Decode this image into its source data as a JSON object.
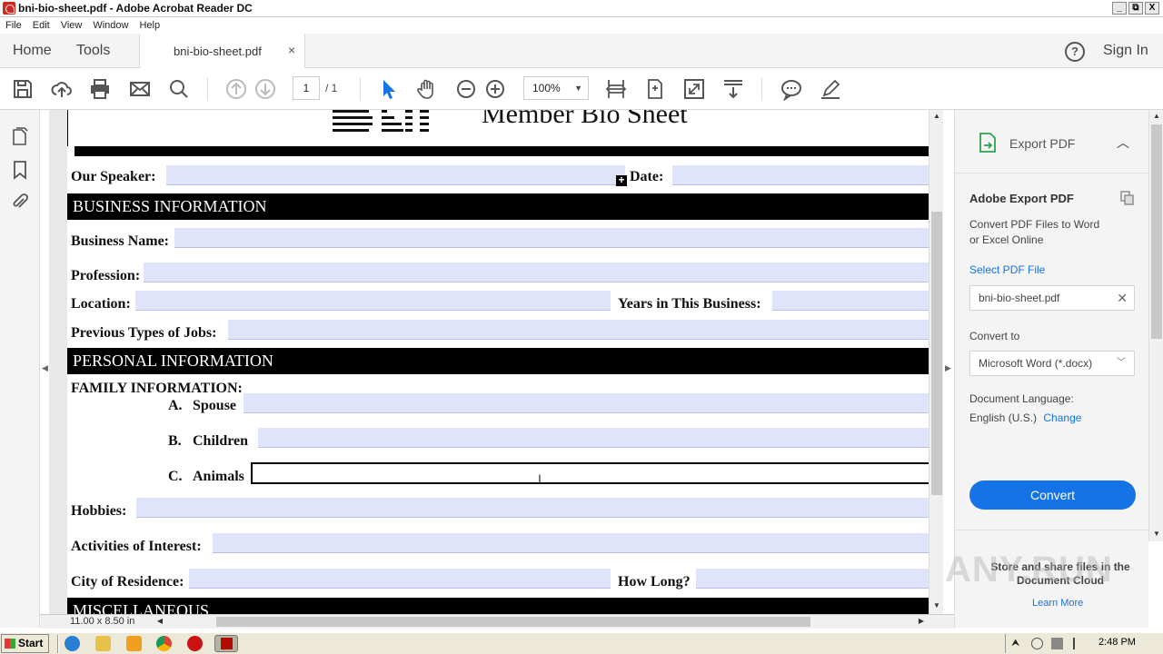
{
  "window": {
    "title": "bni-bio-sheet.pdf - Adobe Acrobat Reader DC",
    "buttons": [
      "_",
      "⧉",
      "X"
    ]
  },
  "menubar": [
    "File",
    "Edit",
    "View",
    "Window",
    "Help"
  ],
  "tabs": {
    "home": "Home",
    "tools": "Tools",
    "document_tab": "bni-bio-sheet.pdf",
    "close": "×",
    "help": "?",
    "sign_in": "Sign In"
  },
  "toolbar": {
    "page_current": "1",
    "page_total": "/ 1",
    "zoom": "100%"
  },
  "document": {
    "title": "Member Bio Sheet",
    "logo_text": "BNI",
    "fields": {
      "speaker": "Our Speaker:",
      "date": "Date:",
      "business_name": "Business Name:",
      "profession": "Profession:",
      "location": "Location:",
      "years": "Years in This Business:",
      "previous_jobs": "Previous Types of Jobs:",
      "family": "FAMILY INFORMATION:",
      "spouse_letter": "A.",
      "spouse": "Spouse",
      "children_letter": "B.",
      "children": "Children",
      "animals_letter": "C.",
      "animals": "Animals",
      "hobbies": "Hobbies:",
      "activities": "Activities of Interest:",
      "city": "City of Residence:",
      "how_long": "How Long?"
    },
    "sections": {
      "business": "BUSINESS INFORMATION",
      "personal": "PERSONAL INFORMATION",
      "misc": "MISCELLANEOUS"
    },
    "page_size": "11.00 x 8.50 in"
  },
  "right_panel": {
    "header": "Export PDF",
    "title": "Adobe Export PDF",
    "description_line1": "Convert PDF Files to Word",
    "description_line2": "or Excel Online",
    "select_label": "Select PDF File",
    "file_name": "bni-bio-sheet.pdf",
    "convert_to_label": "Convert to",
    "convert_to_value": "Microsoft Word (*.docx)",
    "language_label": "Document Language:",
    "language_value": "English (U.S.)",
    "language_change": "Change",
    "convert_button": "Convert",
    "cloud_line1": "Store and share files in the",
    "cloud_line2": "Document Cloud",
    "learn_more": "Learn More"
  },
  "taskbar": {
    "start": "Start",
    "clock": "2:48 PM"
  },
  "watermark": "ANY.RUN",
  "colors": {
    "accent": "#1473e6",
    "field_fill": "#dfe4fb",
    "section_bg": "#000000"
  }
}
